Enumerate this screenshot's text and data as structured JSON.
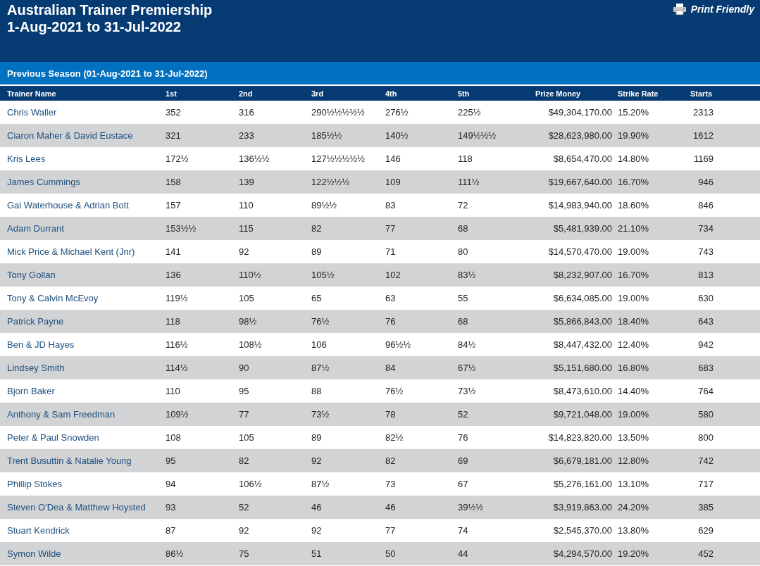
{
  "header": {
    "title_lines": [
      "Australian Trainer Premiership",
      "1-Aug-2021 to 31-Jul-2022"
    ],
    "print_link": "Print Friendly"
  },
  "section": {
    "title": "Previous Season (01-Aug-2021 to 31-Jul-2022)"
  },
  "table": {
    "columns": [
      "Trainer Name",
      "1st",
      "2nd",
      "3rd",
      "4th",
      "5th",
      "Prize Money",
      "Strike Rate",
      "Starts"
    ],
    "rows": [
      [
        "Chris Waller",
        "352",
        "316",
        "290½½½½½",
        "276½",
        "225½",
        "$49,304,170.00",
        "15.20%",
        "2313"
      ],
      [
        "Ciaron Maher & David Eustace",
        "321",
        "233",
        "185½½",
        "140½",
        "149½½½",
        "$28,623,980.00",
        "19.90%",
        "1612"
      ],
      [
        "Kris Lees",
        "172½",
        "136½½",
        "127½½½½½",
        "146",
        "118",
        "$8,654,470.00",
        "14.80%",
        "1169"
      ],
      [
        "James Cummings",
        "158",
        "139",
        "122½½½",
        "109",
        "111½",
        "$19,667,640.00",
        "16.70%",
        "946"
      ],
      [
        "Gai Waterhouse & Adrian Bott",
        "157",
        "110",
        "89½½",
        "83",
        "72",
        "$14,983,940.00",
        "18.60%",
        "846"
      ],
      [
        "Adam Durrant",
        "153½½",
        "115",
        "82",
        "77",
        "68",
        "$5,481,939.00",
        "21.10%",
        "734"
      ],
      [
        "Mick Price & Michael Kent (Jnr)",
        "141",
        "92",
        "89",
        "71",
        "80",
        "$14,570,470.00",
        "19.00%",
        "743"
      ],
      [
        "Tony Gollan",
        "136",
        "110½",
        "105½",
        "102",
        "83½",
        "$8,232,907.00",
        "16.70%",
        "813"
      ],
      [
        "Tony & Calvin McEvoy",
        "119½",
        "105",
        "65",
        "63",
        "55",
        "$6,634,085.00",
        "19.00%",
        "630"
      ],
      [
        "Patrick Payne",
        "118",
        "98½",
        "76½",
        "76",
        "68",
        "$5,866,843.00",
        "18.40%",
        "643"
      ],
      [
        "Ben & JD Hayes",
        "116½",
        "108½",
        "106",
        "96½½",
        "84½",
        "$8,447,432.00",
        "12.40%",
        "942"
      ],
      [
        "Lindsey Smith",
        "114½",
        "90",
        "87½",
        "84",
        "67½",
        "$5,151,680.00",
        "16.80%",
        "683"
      ],
      [
        "Bjorn Baker",
        "110",
        "95",
        "88",
        "76½",
        "73½",
        "$8,473,610.00",
        "14.40%",
        "764"
      ],
      [
        "Anthony & Sam Freedman",
        "109½",
        "77",
        "73½",
        "78",
        "52",
        "$9,721,048.00",
        "19.00%",
        "580"
      ],
      [
        "Peter & Paul Snowden",
        "108",
        "105",
        "89",
        "82½",
        "76",
        "$14,823,820.00",
        "13.50%",
        "800"
      ],
      [
        "Trent Busuttin & Natalie Young",
        "95",
        "82",
        "92",
        "82",
        "69",
        "$6,679,181.00",
        "12.80%",
        "742"
      ],
      [
        "Phillip Stokes",
        "94",
        "106½",
        "87½",
        "73",
        "67",
        "$5,276,161.00",
        "13.10%",
        "717"
      ],
      [
        "Steven O'Dea & Matthew Hoysted",
        "93",
        "52",
        "46",
        "46",
        "39½½",
        "$3,919,863.00",
        "24.20%",
        "385"
      ],
      [
        "Stuart Kendrick",
        "87",
        "92",
        "92",
        "77",
        "74",
        "$2,545,370.00",
        "13.80%",
        "629"
      ],
      [
        "Symon Wilde",
        "86½",
        "75",
        "51",
        "50",
        "44",
        "$4,294,570.00",
        "19.20%",
        "452"
      ]
    ]
  }
}
